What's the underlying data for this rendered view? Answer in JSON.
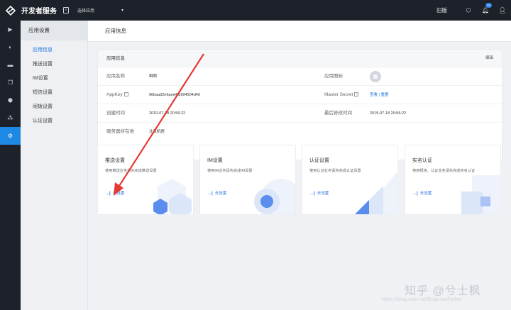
{
  "header": {
    "brand": "开发者服务",
    "app_select": "选择应用",
    "old_version": "旧版",
    "notification_count": "46"
  },
  "sidebar": {
    "title": "应用设置",
    "items": [
      {
        "label": "应用信息",
        "active": true
      },
      {
        "label": "推送设置",
        "active": false
      },
      {
        "label": "IM设置",
        "active": false
      },
      {
        "label": "短信设置",
        "active": false
      },
      {
        "label": "闹拨设置",
        "active": false
      },
      {
        "label": "认证设置",
        "active": false
      }
    ]
  },
  "page": {
    "title": "应用信息"
  },
  "info_panel": {
    "title": "应用信息",
    "edit_label": "编辑",
    "app_name_label": "应用名称",
    "app_name_value": "啊啊",
    "app_icon_label": "应用图标",
    "appkey_label": "AppKey",
    "appkey_value": "96baa32e6aed4fb994004d40",
    "master_secret_label": "Master Secret",
    "master_secret_actions": "查看 | 重置",
    "created_label": "创建时间",
    "created_value": "2019-07-18 20:56:22",
    "modified_label": "最后修改时间",
    "modified_value": "2019-07-18 20:56:22",
    "server_label": "服务器所在地",
    "server_value": "北京机房"
  },
  "cards": [
    {
      "title": "推送设置",
      "desc": "使用推送业务请先完成推送设置",
      "link": "去设置"
    },
    {
      "title": "IM设置",
      "desc": "使用IM业务请先完成IM设置",
      "link": "去设置"
    },
    {
      "title": "认证设置",
      "desc": "使用认证业务请先完成认证设置",
      "link": "去设置"
    },
    {
      "title": "实名认证",
      "desc": "使用短信、认证业务请先完成实名认证",
      "link": "去设置"
    }
  ],
  "watermark": {
    "text": "知乎 @兮士枫",
    "url": "https://blog.csdn.net/BugLoadFather"
  },
  "colors": {
    "topbar": "#1d2129",
    "accent": "#1e88e5",
    "link": "#1e6fe0",
    "annotation_arrow": "#e53935"
  }
}
